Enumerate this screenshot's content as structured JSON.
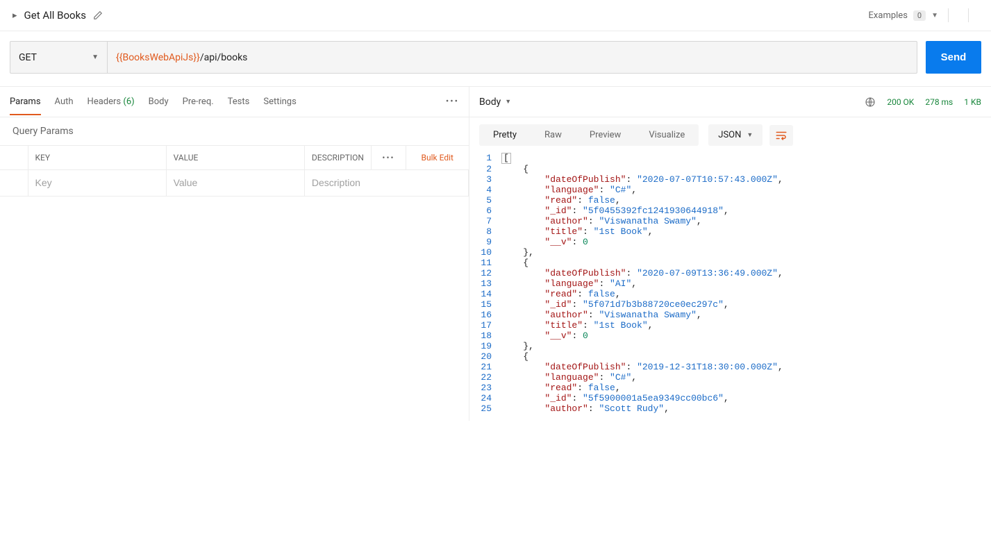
{
  "header": {
    "title": "Get All Books",
    "examples_label": "Examples",
    "examples_count": "0"
  },
  "request": {
    "method": "GET",
    "url_var": "{{BooksWebApiJs}}",
    "url_path": "/api/books",
    "send_label": "Send"
  },
  "req_tabs": {
    "params": "Params",
    "auth": "Auth",
    "headers": "Headers",
    "headers_count": "(6)",
    "body": "Body",
    "prereq": "Pre-req.",
    "tests": "Tests",
    "settings": "Settings"
  },
  "query": {
    "title": "Query Params",
    "key_hdr": "KEY",
    "value_hdr": "VALUE",
    "desc_hdr": "DESCRIPTION",
    "bulk": "Bulk Edit",
    "key_ph": "Key",
    "value_ph": "Value",
    "desc_ph": "Description"
  },
  "response": {
    "tab": "Body",
    "status": "200 OK",
    "time": "278 ms",
    "size": "1 KB",
    "views": {
      "pretty": "Pretty",
      "raw": "Raw",
      "preview": "Preview",
      "visualize": "Visualize"
    },
    "format": "JSON"
  },
  "code_lines": [
    {
      "n": "1",
      "indent": 0,
      "tokens": [
        {
          "t": "box",
          "v": "["
        }
      ]
    },
    {
      "n": "2",
      "indent": 1,
      "tokens": [
        {
          "t": "p",
          "v": "{"
        }
      ]
    },
    {
      "n": "3",
      "indent": 2,
      "tokens": [
        {
          "t": "k",
          "v": "\"dateOfPublish\""
        },
        {
          "t": "p",
          "v": ": "
        },
        {
          "t": "s",
          "v": "\"2020-07-07T10:57:43.000Z\""
        },
        {
          "t": "p",
          "v": ","
        }
      ]
    },
    {
      "n": "4",
      "indent": 2,
      "tokens": [
        {
          "t": "k",
          "v": "\"language\""
        },
        {
          "t": "p",
          "v": ": "
        },
        {
          "t": "s",
          "v": "\"C#\""
        },
        {
          "t": "p",
          "v": ","
        }
      ]
    },
    {
      "n": "5",
      "indent": 2,
      "tokens": [
        {
          "t": "k",
          "v": "\"read\""
        },
        {
          "t": "p",
          "v": ": "
        },
        {
          "t": "b",
          "v": "false"
        },
        {
          "t": "p",
          "v": ","
        }
      ]
    },
    {
      "n": "6",
      "indent": 2,
      "tokens": [
        {
          "t": "k",
          "v": "\"_id\""
        },
        {
          "t": "p",
          "v": ": "
        },
        {
          "t": "s",
          "v": "\"5f0455392fc1241930644918\""
        },
        {
          "t": "p",
          "v": ","
        }
      ]
    },
    {
      "n": "7",
      "indent": 2,
      "tokens": [
        {
          "t": "k",
          "v": "\"author\""
        },
        {
          "t": "p",
          "v": ": "
        },
        {
          "t": "s",
          "v": "\"Viswanatha Swamy\""
        },
        {
          "t": "p",
          "v": ","
        }
      ]
    },
    {
      "n": "8",
      "indent": 2,
      "tokens": [
        {
          "t": "k",
          "v": "\"title\""
        },
        {
          "t": "p",
          "v": ": "
        },
        {
          "t": "s",
          "v": "\"1st Book\""
        },
        {
          "t": "p",
          "v": ","
        }
      ]
    },
    {
      "n": "9",
      "indent": 2,
      "tokens": [
        {
          "t": "k",
          "v": "\"__v\""
        },
        {
          "t": "p",
          "v": ": "
        },
        {
          "t": "n",
          "v": "0"
        }
      ]
    },
    {
      "n": "10",
      "indent": 1,
      "tokens": [
        {
          "t": "p",
          "v": "},"
        }
      ]
    },
    {
      "n": "11",
      "indent": 1,
      "tokens": [
        {
          "t": "p",
          "v": "{"
        }
      ]
    },
    {
      "n": "12",
      "indent": 2,
      "tokens": [
        {
          "t": "k",
          "v": "\"dateOfPublish\""
        },
        {
          "t": "p",
          "v": ": "
        },
        {
          "t": "s",
          "v": "\"2020-07-09T13:36:49.000Z\""
        },
        {
          "t": "p",
          "v": ","
        }
      ]
    },
    {
      "n": "13",
      "indent": 2,
      "tokens": [
        {
          "t": "k",
          "v": "\"language\""
        },
        {
          "t": "p",
          "v": ": "
        },
        {
          "t": "s",
          "v": "\"AI\""
        },
        {
          "t": "p",
          "v": ","
        }
      ]
    },
    {
      "n": "14",
      "indent": 2,
      "tokens": [
        {
          "t": "k",
          "v": "\"read\""
        },
        {
          "t": "p",
          "v": ": "
        },
        {
          "t": "b",
          "v": "false"
        },
        {
          "t": "p",
          "v": ","
        }
      ]
    },
    {
      "n": "15",
      "indent": 2,
      "tokens": [
        {
          "t": "k",
          "v": "\"_id\""
        },
        {
          "t": "p",
          "v": ": "
        },
        {
          "t": "s",
          "v": "\"5f071d7b3b88720ce0ec297c\""
        },
        {
          "t": "p",
          "v": ","
        }
      ]
    },
    {
      "n": "16",
      "indent": 2,
      "tokens": [
        {
          "t": "k",
          "v": "\"author\""
        },
        {
          "t": "p",
          "v": ": "
        },
        {
          "t": "s",
          "v": "\"Viswanatha Swamy\""
        },
        {
          "t": "p",
          "v": ","
        }
      ]
    },
    {
      "n": "17",
      "indent": 2,
      "tokens": [
        {
          "t": "k",
          "v": "\"title\""
        },
        {
          "t": "p",
          "v": ": "
        },
        {
          "t": "s",
          "v": "\"1st Book\""
        },
        {
          "t": "p",
          "v": ","
        }
      ]
    },
    {
      "n": "18",
      "indent": 2,
      "tokens": [
        {
          "t": "k",
          "v": "\"__v\""
        },
        {
          "t": "p",
          "v": ": "
        },
        {
          "t": "n",
          "v": "0"
        }
      ]
    },
    {
      "n": "19",
      "indent": 1,
      "tokens": [
        {
          "t": "p",
          "v": "},"
        }
      ]
    },
    {
      "n": "20",
      "indent": 1,
      "tokens": [
        {
          "t": "p",
          "v": "{"
        }
      ]
    },
    {
      "n": "21",
      "indent": 2,
      "tokens": [
        {
          "t": "k",
          "v": "\"dateOfPublish\""
        },
        {
          "t": "p",
          "v": ": "
        },
        {
          "t": "s",
          "v": "\"2019-12-31T18:30:00.000Z\""
        },
        {
          "t": "p",
          "v": ","
        }
      ]
    },
    {
      "n": "22",
      "indent": 2,
      "tokens": [
        {
          "t": "k",
          "v": "\"language\""
        },
        {
          "t": "p",
          "v": ": "
        },
        {
          "t": "s",
          "v": "\"C#\""
        },
        {
          "t": "p",
          "v": ","
        }
      ]
    },
    {
      "n": "23",
      "indent": 2,
      "tokens": [
        {
          "t": "k",
          "v": "\"read\""
        },
        {
          "t": "p",
          "v": ": "
        },
        {
          "t": "b",
          "v": "false"
        },
        {
          "t": "p",
          "v": ","
        }
      ]
    },
    {
      "n": "24",
      "indent": 2,
      "tokens": [
        {
          "t": "k",
          "v": "\"_id\""
        },
        {
          "t": "p",
          "v": ": "
        },
        {
          "t": "s",
          "v": "\"5f5900001a5ea9349cc00bc6\""
        },
        {
          "t": "p",
          "v": ","
        }
      ]
    },
    {
      "n": "25",
      "indent": 2,
      "tokens": [
        {
          "t": "k",
          "v": "\"author\""
        },
        {
          "t": "p",
          "v": ": "
        },
        {
          "t": "s",
          "v": "\"Scott Rudy\""
        },
        {
          "t": "p",
          "v": ","
        }
      ]
    }
  ]
}
